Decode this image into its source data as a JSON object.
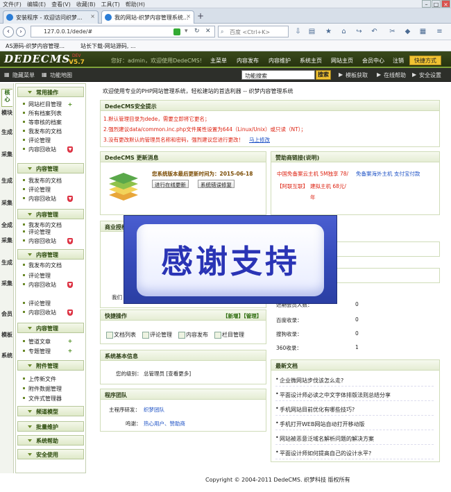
{
  "browser": {
    "menu": [
      "文件(F)",
      "编辑(E)",
      "查看(V)",
      "收藏(B)",
      "工具(T)",
      "帮助(H)"
    ],
    "tabs": [
      {
        "label": "安装程序 - 欢迎访问织梦..."
      },
      {
        "label": "我的网站-织梦内容管理系统..."
      }
    ],
    "url": "127.0.0.1/dede/#",
    "search_placeholder": "百度 <Ctrl+K>",
    "bookmarks": [
      "AS源码-织梦内容管理...",
      "站长下载-网站源码, ..."
    ]
  },
  "header": {
    "logo": "DEDECMS",
    "version": "V5.7",
    "dev": "DEV",
    "welcome": "您好：admin，欢迎使用DedeCMS!",
    "nav": [
      "主菜单",
      "内容发布",
      "内容维护",
      "系统主页",
      "网站主页",
      "会员中心",
      "注销"
    ],
    "quickway": "快捷方式"
  },
  "subbar": {
    "hide_menu": "隐藏菜单",
    "func_map": "功能地图",
    "func_search": "功能搜索",
    "search_btn": "搜索",
    "template": "模板获取",
    "help": "在线帮助",
    "security": "安全设置"
  },
  "vtabs": [
    "核心",
    "模块",
    "生成",
    "采集",
    "会员",
    "模板",
    "系统"
  ],
  "vtabs_extra": [
    "生成",
    "采集",
    "生成",
    "采集",
    "全成",
    "采集",
    "生成",
    "采集"
  ],
  "leftmenu": {
    "sections": [
      {
        "title": "常用操作",
        "items": [
          "网站栏目管理",
          "所有档案列表",
          "等审核的档案",
          "我发布的文档",
          "评论管理",
          "内容回收站"
        ]
      },
      {
        "title": "内容管理",
        "items": [
          "我发布的文档",
          "评论管理",
          "内容回收站"
        ]
      },
      {
        "title": "内容管理",
        "items": [
          "我发布的文档",
          "评论管理",
          "内容回收站"
        ]
      },
      {
        "title": "内容管理",
        "items": [
          "我发布的文档",
          "评论管理",
          "内容回收站"
        ]
      },
      {
        "title": "内容管理",
        "items": [
          "管道文章",
          "专题管理"
        ]
      },
      {
        "title": "附件管理",
        "items": [
          "上传新文件",
          "附件数据管理",
          "文件式管理器"
        ]
      },
      {
        "title": "频道模型",
        "items": []
      },
      {
        "title": "批量维护",
        "items": []
      },
      {
        "title": "系统帮助",
        "items": []
      },
      {
        "title": "安全使用",
        "items": []
      }
    ]
  },
  "main": {
    "intro": "欢迎使用专业的PHP网站管理系统，轻松建站的首选利器 -- 织梦内容管理系统",
    "security": {
      "title": "DedeCMS安全提示",
      "lines": [
        "1.默认管理目录为dede，需要立即将它更名；",
        "2.强烈建议data/common.inc.php文件属性设置为644（Linux/Unix）或只读（NT）；",
        "3.没有更改默认的管理员名称和密码，强烈建议您进行更改！"
      ],
      "link": "马上修改"
    },
    "update": {
      "title": "DedeCMS 更新消息",
      "text": "您系统版本最后更新时间为：2015-06-18",
      "btn1": "进行在线更新",
      "btn2": "系统错误修复"
    },
    "sponsor": {
      "title": "赞助商链接(说明)",
      "l1a": "中国免备案云主机 5M独享 78/",
      "l1b": "免备案海外主机 支付宝付款",
      "l2a": "【阿联互联】",
      "l2b": "建拟主机 68元/",
      "l2c": "年"
    },
    "commercial": {
      "title": "商业授权",
      "text": "我们"
    },
    "quick": {
      "title": "快捷操作",
      "links": "【新增】【管理】",
      "items": [
        "文档列表",
        "评论管理",
        "内容发布",
        "栏目管理"
      ]
    },
    "sysinfo": {
      "title": "系统基本信息",
      "label": "您的级别：",
      "value": "总管理员 [查看更多]"
    },
    "team": {
      "title": "程序团队",
      "r1k": "主程序研发：",
      "r1v": "织梦团队",
      "r2k": "鸣谢：",
      "r2v": "热心用户、赞助商"
    },
    "stats": [
      {
        "k": "近期会员人数：",
        "v": "0"
      },
      {
        "k": "百度收录：",
        "v": "0"
      },
      {
        "k": "搜狗收录：",
        "v": "0"
      },
      {
        "k": "360收录：",
        "v": "1"
      }
    ],
    "news": {
      "title": "最新文档",
      "items": [
        "企业微网站步伐该怎么走?",
        "平面设计师必读之中文字体排版法则总结分享",
        "手机网站目前优化有哪些技巧?",
        "手机打开WEB网站自动打开移动版",
        "网站被恶意泛域名解析问题的解决方案",
        "平面设计师如何提高自己的设计水平?"
      ]
    },
    "footer": "Copyright © 2004-2011 DedeCMS. 织梦科技 版权所有"
  },
  "overlay": {
    "text": "感谢支持"
  }
}
